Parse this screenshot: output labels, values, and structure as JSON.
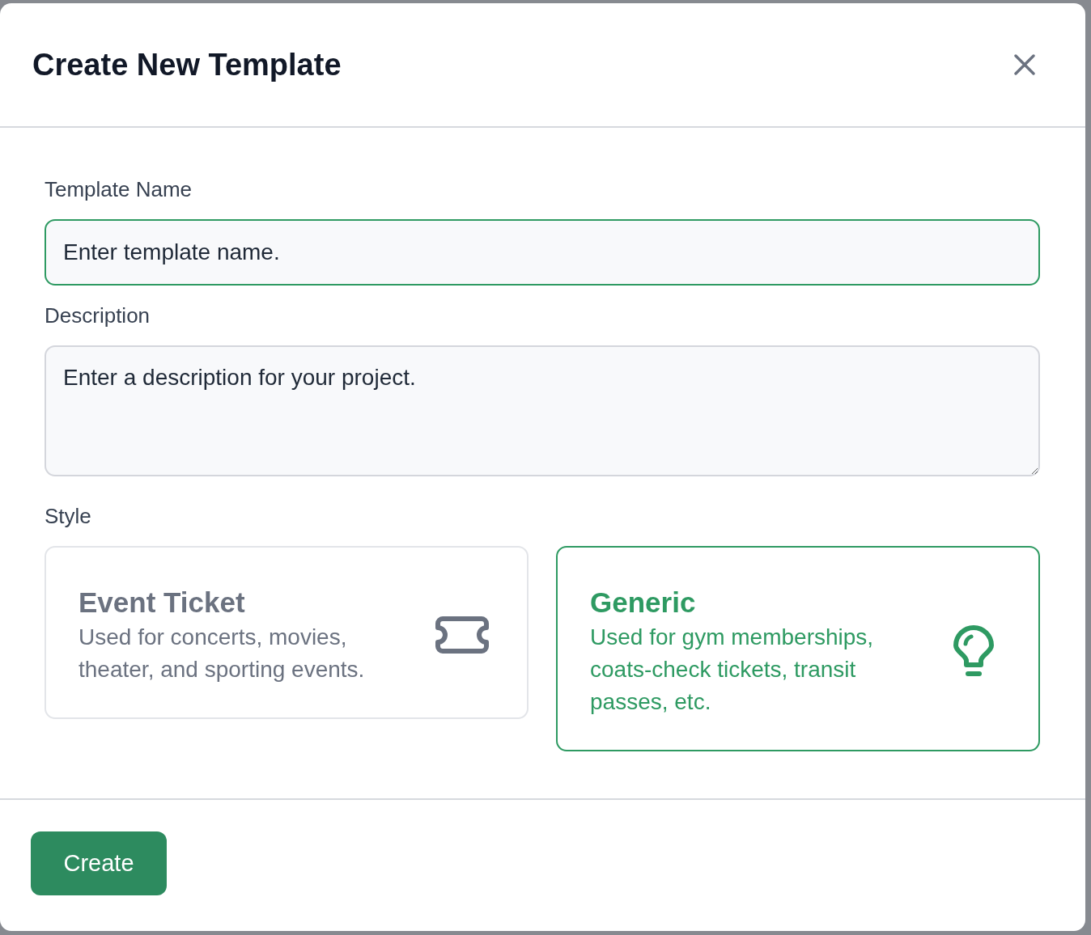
{
  "dialog": {
    "title": "Create New Template"
  },
  "fields": [
    {
      "kind": "input",
      "label": "Template Name",
      "placeholder": "Enter template name.",
      "focused": true
    },
    {
      "kind": "textarea",
      "label": "Description",
      "placeholder": "Enter a description for your project.",
      "focused": false
    }
  ],
  "style": {
    "label": "Style",
    "options": [
      {
        "kind": "event",
        "title": "Event Ticket",
        "description": "Used for concerts, movies, theater, and sporting events.",
        "selected": false
      },
      {
        "kind": "generic",
        "title": "Generic",
        "description": "Used for gym memberships, coats-check tickets, transit passes, etc.",
        "selected": true
      }
    ]
  },
  "footer": {
    "button": "Create"
  }
}
